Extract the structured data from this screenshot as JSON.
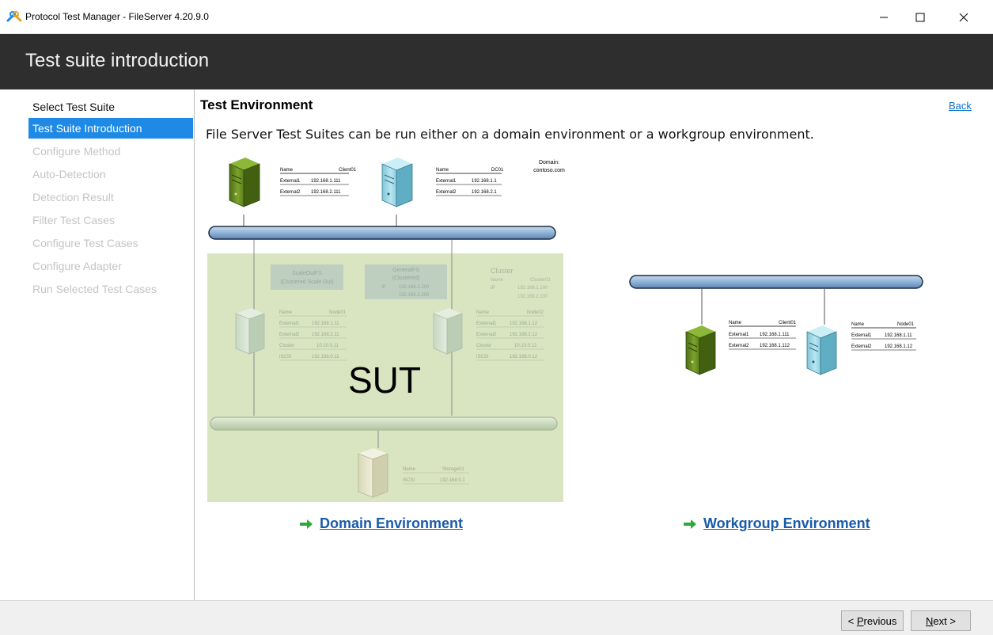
{
  "window": {
    "title": "Protocol Test Manager - FileServer 4.20.9.0",
    "minimize_icon": "minimize-icon",
    "maximize_icon": "maximize-icon",
    "close_icon": "close-icon"
  },
  "header": {
    "title": "Test suite introduction"
  },
  "sidebar": {
    "items": [
      {
        "label": "Select Test Suite",
        "state": "done"
      },
      {
        "label": "Test Suite Introduction",
        "state": "active"
      },
      {
        "label": "Configure Method",
        "state": "disabled"
      },
      {
        "label": "Auto-Detection",
        "state": "disabled"
      },
      {
        "label": "Detection Result",
        "state": "disabled"
      },
      {
        "label": "Filter Test Cases",
        "state": "disabled"
      },
      {
        "label": "Configure Test Cases",
        "state": "disabled"
      },
      {
        "label": "Configure Adapter",
        "state": "disabled"
      },
      {
        "label": "Run Selected Test Cases",
        "state": "disabled"
      }
    ]
  },
  "main": {
    "section_title": "Test Environment",
    "back_label": "Back",
    "intro_text": "File Server Test Suites can be run either on a domain environment or a workgroup environment.",
    "domain_link": "Domain Environment",
    "workgroup_link": "Workgroup Environment",
    "arrow_icon": "right-arrow-icon"
  },
  "domain_diagram": {
    "domain_label": "Domain:",
    "domain_value": "contoso.com",
    "client": {
      "name_label": "Name",
      "name_value": "Client01",
      "rows": [
        [
          "External1",
          "192.168.1.111"
        ],
        [
          "External2",
          "192.168.2.111"
        ]
      ]
    },
    "dc": {
      "name_label": "Name",
      "name_value": "DC01",
      "rows": [
        [
          "External1",
          "192.168.1.1"
        ],
        [
          "External2",
          "192.168.2.1"
        ]
      ]
    },
    "sut_label": "SUT",
    "scaleout": {
      "line1": "ScaleOutFS",
      "line2": "(Clustered Scale Out)"
    },
    "generalfs": {
      "line1": "GeneralFS",
      "line2": "(Clustered)",
      "ip_label": "IP",
      "ip1": "192.168.1.200",
      "ip2": "192.168.2.200"
    },
    "cluster": {
      "title": "Cluster",
      "name_label": "Name",
      "name_value": "Cluster01",
      "ip_label": "IP",
      "ip1": "192.168.1.100",
      "ip2": "192.168.2.100"
    },
    "node1": {
      "name_label": "Name",
      "name_value": "Node01",
      "rows": [
        [
          "External1",
          "192.168.1.11"
        ],
        [
          "External2",
          "192.168.2.11"
        ],
        [
          "Cluster",
          "10.10.0.11"
        ],
        [
          "iSCSI",
          "192.168.0.11"
        ]
      ]
    },
    "node2": {
      "name_label": "Name",
      "name_value": "Node02",
      "rows": [
        [
          "External1",
          "192.168.1.12"
        ],
        [
          "External2",
          "192.168.2.12"
        ],
        [
          "Cluster",
          "10.10.0.12"
        ],
        [
          "iSCSI",
          "192.168.0.12"
        ]
      ]
    },
    "storage": {
      "name_label": "Name",
      "name_value": "Storage01",
      "rows": [
        [
          "iSCSI",
          "192.168.0.1"
        ]
      ]
    }
  },
  "workgroup_diagram": {
    "client": {
      "name_label": "Name",
      "name_value": "Client01",
      "rows": [
        [
          "External1",
          "192.168.1.111"
        ],
        [
          "External2",
          "192.168.1.112"
        ]
      ]
    },
    "node": {
      "name_label": "Name",
      "name_value": "Node01",
      "rows": [
        [
          "External1",
          "192.168.1.11"
        ],
        [
          "External2",
          "192.168.1.12"
        ]
      ]
    }
  },
  "footer": {
    "prev_prefix": "< ",
    "prev_key": "P",
    "prev_rest": "revious",
    "next_key": "N",
    "next_rest": "ext >"
  },
  "colors": {
    "header_bg": "#2e2e2e",
    "active_item": "#1e8ae6",
    "link": "#1a5ba8",
    "sut_area": "#d9e4c1",
    "network_bus": "#8fb3d6",
    "client_server": "#6c8f25",
    "dc_server": "#a8dce9"
  }
}
